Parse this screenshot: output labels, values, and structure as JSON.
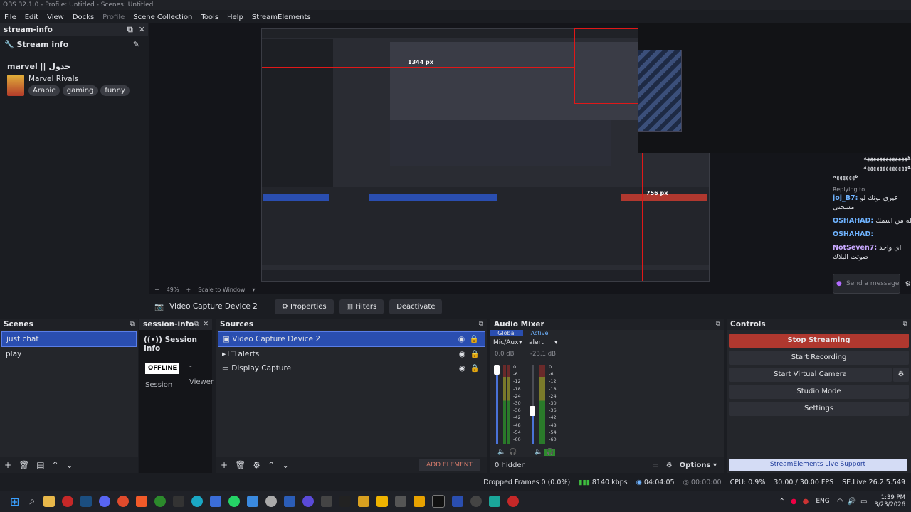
{
  "window": {
    "title": "OBS 32.1.0 - Profile: Untitled - Scenes: Untitled"
  },
  "menu": [
    "File",
    "Edit",
    "View",
    "Docks",
    "Profile",
    "Scene Collection",
    "Tools",
    "Help",
    "StreamElements"
  ],
  "stream_info_dock": {
    "title": "stream-info",
    "header": "Stream info",
    "stream_title": "marvel || جدول",
    "game": "Marvel Rivals",
    "tags": [
      "Arabic",
      "gaming",
      "funny"
    ]
  },
  "preview": {
    "inner_labels": {
      "measure_h": "1344 px",
      "measure_v": "756 px"
    },
    "zoom": "49%",
    "scale_mode": "Scale to Window"
  },
  "source_bar": {
    "source_name": "Video Capture Device 2",
    "properties": "Properties",
    "filters": "Filters",
    "deactivate": "Deactivate"
  },
  "chat": {
    "lines": [
      {
        "user": "",
        "text": "ههههههههههههههه"
      },
      {
        "user": "",
        "text": "ههههههههههههههه"
      },
      {
        "user": "",
        "text": "هههههههه"
      },
      {
        "user": "",
        "text": "Replying to ..."
      },
      {
        "user": "joj_B7:",
        "text": "عيري لونك لو"
      },
      {
        "user": "",
        "text": "مسخني"
      },
      {
        "user": "OSHAHAD:",
        "text": "كله من اسمك"
      },
      {
        "user": "OSHAHAD:",
        "text": ""
      },
      {
        "user": "NotSeven7:",
        "text": "اي واحد"
      },
      {
        "user": "",
        "text": "صوتت البلاك"
      }
    ],
    "send_placeholder": "Send a message"
  },
  "scenes": {
    "title": "Scenes",
    "items": [
      "just chat",
      "play"
    ],
    "selected": 0
  },
  "session_info": {
    "title": "session-info",
    "header": "Session Info",
    "status": "OFFLINE",
    "dash": "-",
    "session_label": "Session",
    "viewer_label": "Viewer"
  },
  "sources": {
    "title": "Sources",
    "items": [
      {
        "name": "Video Capture Device 2",
        "icon": "camera-icon"
      },
      {
        "name": "alerts",
        "icon": "folder-icon"
      },
      {
        "name": "Display Capture",
        "icon": "monitor-icon"
      }
    ],
    "add_element": "ADD ELEMENT"
  },
  "audio_mixer": {
    "title": "Audio Mixer",
    "tab_global": "Global",
    "tab_active": "Active",
    "channels": [
      {
        "name": "Mic/Aux",
        "db": "0.0 dB",
        "level": 0.55,
        "volume": 1.0
      },
      {
        "name": "alert",
        "db": "-23.1 dB",
        "level": 0.35,
        "volume": 0.45
      }
    ],
    "scale": [
      "0",
      "-6",
      "-12",
      "-18",
      "-24",
      "-30",
      "-36",
      "-42",
      "-48",
      "-54",
      "-60"
    ],
    "hidden": "0 hidden",
    "options": "Options"
  },
  "controls": {
    "title": "Controls",
    "stop_streaming": "Stop Streaming",
    "start_recording": "Start Recording",
    "start_virtual_camera": "Start Virtual Camera",
    "studio_mode": "Studio Mode",
    "settings": "Settings",
    "live_support": "StreamElements Live Support"
  },
  "status": {
    "dropped": "Dropped Frames 0 (0.0%)",
    "bitrate": "8140 kbps",
    "stream_time": "04:04:05",
    "rec_time": "00:00:00",
    "cpu": "CPU: 0.9%",
    "fps": "30.00 / 30.00 FPS",
    "se": "SE.Live 26.2.5.549"
  },
  "taskbar": {
    "lang": "ENG",
    "time": "1:39 PM",
    "date": "3/23/2026"
  },
  "colors": {
    "stop_red": "#b0382f",
    "selection_blue": "#2a4eb0",
    "live_support": "#d4dcf5"
  }
}
